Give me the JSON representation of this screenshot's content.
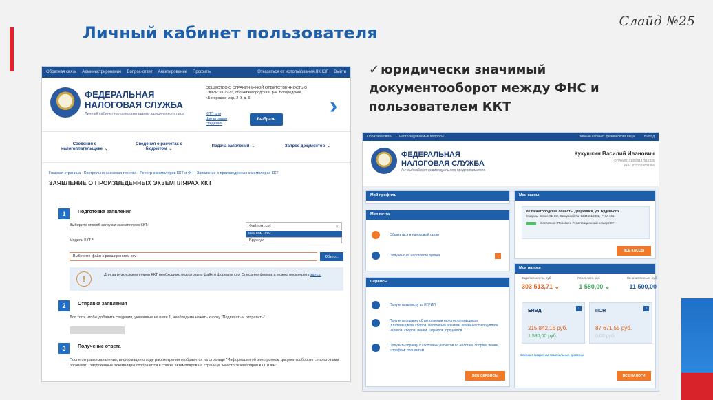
{
  "slide": {
    "title": "Личный кабинет пользователя",
    "slide_number": "Слайд №25",
    "note_check": "✓",
    "note_text": "юридически значимый документооборот между ФНС и пользователем ККТ",
    "colors": {
      "title": "#1f5ea8",
      "accent_red": "#e0242d",
      "accent_blue": "#1f6fc6"
    }
  },
  "shot1": {
    "topbar_left": [
      "Обратная связь",
      "Администрирование",
      "Вопрос-ответ",
      "Анкетирование",
      "Профиль"
    ],
    "topbar_right": [
      "Отказаться от использования ЛК ЮЛ",
      "Выйти"
    ],
    "fns_line1": "ФЕДЕРАЛЬНАЯ",
    "fns_line2": "НАЛОГОВАЯ СЛУЖБА",
    "fns_sub": "Личный кабинет налогоплательщика юридического лица",
    "org_text": "ОБЩЕСТВО С ОГРАНИЧЕННОЙ ОТВЕТСТВЕННОСТЬЮ \"ЭФИР\" 601920, обл.Нижегородская, р-н. Богородский, г.Богородск, мкр. 2-й, д. 6",
    "org_link": "КПП для фильтрации сведений",
    "exit_label": "Выбрать",
    "menu": [
      "Сведения о налогоплательщике",
      "Сведения о расчетах с бюджетом",
      "Подача заявлений",
      "Запрос документов"
    ],
    "chev": "⌄",
    "arrow": "›",
    "breadcrumb": "Главная страница · Контрольно-кассовая техника · Реестр экземпляров ККТ и ФН · Заявление о произведенных экземплярах ККТ",
    "heading": "ЗАЯВЛЕНИЕ О ПРОИЗВЕДЕННЫХ ЭКЗЕМПЛЯРАХ ККТ",
    "step1": {
      "num": "1",
      "title": "Подготовка заявления",
      "method_label": "Выберите способ загрузки экземпляров ККТ:",
      "method_value": "Файлом .csv",
      "options": [
        "Файлом .csv",
        "Вручную"
      ],
      "model_label": "Модель ККТ *",
      "file_placeholder": "Выберите файл с расширением csv",
      "browse_label": "Обзор...",
      "info_icon": "!",
      "info_text": "Для загрузки экземпляров ККТ необходимо подготовить файл в формате csv. Описание формата можно посмотреть",
      "info_link": "здесь."
    },
    "step2": {
      "num": "2",
      "title": "Отправка заявления",
      "text": "Для того, чтобы добавить сведения, указанные на шаге 1, необходимо нажать кнопку \"Подписать и отправить\""
    },
    "step3": {
      "num": "3",
      "title": "Получение ответа",
      "text": "После отправки заявления, информация о ходе рассмотрения отобразится на странице \"Информация об электронном документообороте с налоговыми органами\". Загруженные экземпляры отобразятся в списке экземпляров на странице \"Реестр экземпляров ККТ и ФН\""
    }
  },
  "shot2": {
    "topbar": [
      "Обратная связь",
      "Часто задаваемые вопросы",
      "Личный кабинет физического лица",
      "Выход"
    ],
    "fns_line1": "ФЕДЕРАЛЬНАЯ",
    "fns_line2": "НАЛОГОВАЯ СЛУЖБА",
    "fns_sub": "Личный кабинет индивидуального предпринимателя",
    "user_name": "Кукушкин Василий Иванович",
    "ogrnip": "ОГРНИП: 314505147512335",
    "inn": "ИНН: 0332119004456",
    "profile_title": "Мой профиль",
    "mail_title": "Моя почта",
    "mail_items": [
      "Обратиться в налоговый орган",
      "Получено из налогового органа"
    ],
    "mail_badge": "1",
    "services_title": "Сервисы",
    "services_items": [
      "Получить выписку из ЕГРИП",
      "Получить справку об исполнении налогоплательщиком (плательщиком сборов, налоговым агентом) обязанности по уплате налогов, сборов, пеней, штрафов, процентов",
      "Получить справку о состоянии расчетов по налогам, сборам, пеням, штрафам, процентам"
    ],
    "services_btn": "ВСЕ СЕРВИСЫ",
    "kassy_title": "Мои кассы",
    "kassa_address": "82 Нижегородская область, Дзержинск, ул. Буденного",
    "kassa_model": "Модель: Элвес-01-ОЗ, Заводской №: 12345612302, РНМ 161",
    "kassa_status": "Состояние: Присвоен Регистрационный номер ККТ",
    "kassy_btn": "ВСЕ КАССЫ",
    "taxes_title": "Мои налоги",
    "debt_label": "Задолженность, руб",
    "over_label": "Переплата, руб",
    "unpaid_label": "Неначисленные, руб",
    "debt_value": "303 513,71 ⌄",
    "over_value": "1 580,00 ⌄",
    "unpaid_value": "11 500,00",
    "envd_name": "ЕНВД",
    "envd_v1": "215 842,16 руб.",
    "envd_v2": "1 580,00 руб.",
    "psn_name": "ПСН",
    "psn_v1": "87 671,55 руб.",
    "psn_v2": "0,00 руб.",
    "card_mark": "i",
    "taxes_footer": "Сверки с бюджетом Камеральные проверки",
    "taxes_btn": "ВСЕ НАЛОГИ",
    "colors": {
      "debt": "#e0651f",
      "over": "#3fa35a",
      "unpaid": "#1f5ea8"
    }
  }
}
